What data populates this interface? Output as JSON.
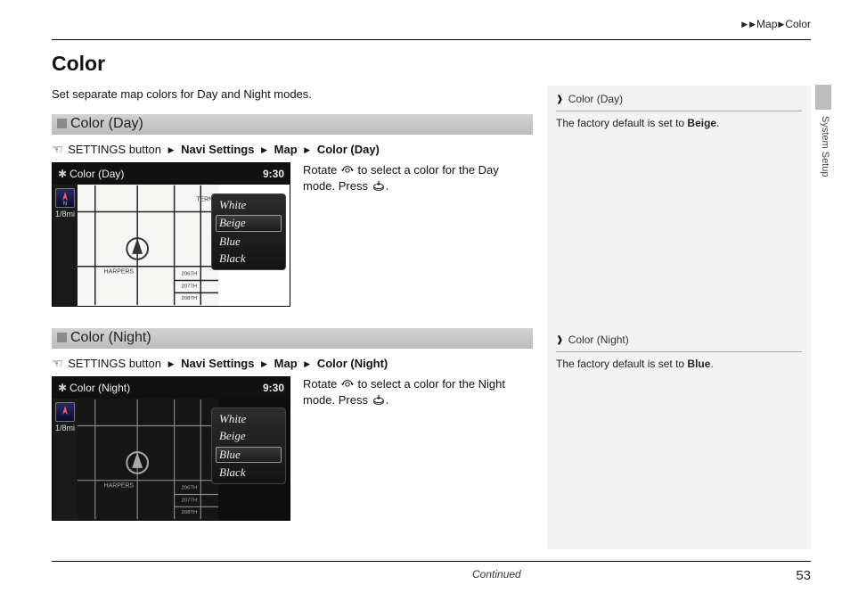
{
  "breadcrumb": {
    "lvl1": "Map",
    "lvl2": "Color"
  },
  "side_section": "System Setup",
  "page_title": "Color",
  "intro": "Set separate map colors for Day and Night modes.",
  "sections": {
    "day": {
      "heading": "Color (Day)",
      "path": {
        "prefix": "SETTINGS button",
        "p1": "Navi Settings",
        "p2": "Map",
        "p3": "Color (Day)"
      },
      "instr_a": "Rotate ",
      "instr_b": " to select a color for the Day mode. Press ",
      "instr_c": ".",
      "screenshot": {
        "title": "Color (Day)",
        "clock": "9:30",
        "scale": "1/8mi",
        "options": [
          "White",
          "Beige",
          "Blue",
          "Black"
        ],
        "selected": "Beige",
        "roads": [
          "HARPERS",
          "206TH",
          "207TH",
          "208TH"
        ]
      }
    },
    "night": {
      "heading": "Color (Night)",
      "path": {
        "prefix": "SETTINGS button",
        "p1": "Navi Settings",
        "p2": "Map",
        "p3": "Color (Night)"
      },
      "instr_a": "Rotate ",
      "instr_b": " to select a color for the Night mode. Press ",
      "instr_c": ".",
      "screenshot": {
        "title": "Color (Night)",
        "clock": "9:30",
        "scale": "1/8mi",
        "options": [
          "White",
          "Beige",
          "Blue",
          "Black"
        ],
        "selected": "Blue",
        "roads": [
          "HARPERS",
          "206TH",
          "207TH",
          "208TH"
        ]
      }
    }
  },
  "sidebar": {
    "day": {
      "title": "Color (Day)",
      "text_a": "The factory default is set to ",
      "bold": "Beige",
      "text_b": "."
    },
    "night": {
      "title": "Color (Night)",
      "text_a": "The factory default is set to ",
      "bold": "Blue",
      "text_b": "."
    }
  },
  "footer": {
    "continued": "Continued",
    "page": "53"
  }
}
